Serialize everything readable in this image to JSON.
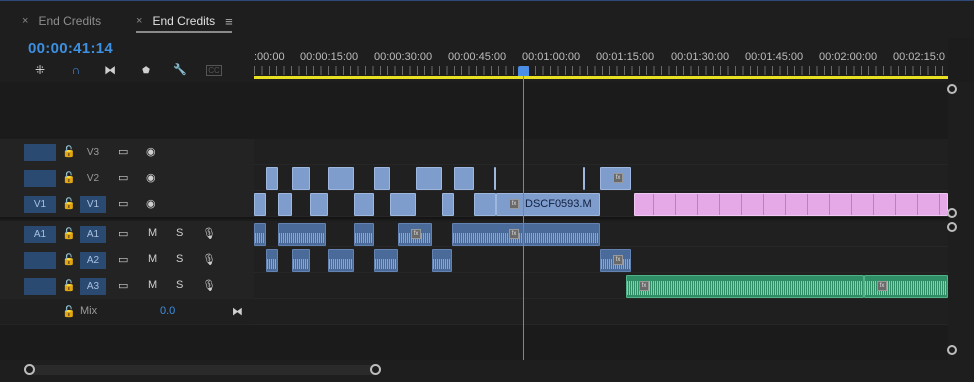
{
  "tabs": [
    {
      "close": "×",
      "label": "End Credits",
      "active": false
    },
    {
      "close": "×",
      "label": "End Credits",
      "active": true,
      "menu": "≡"
    }
  ],
  "timecode": "00:00:41:14",
  "toolbar": {
    "tools": [
      {
        "name": "insert-overwrite-icon",
        "glyph": "⁜"
      },
      {
        "name": "snap-magnet-icon",
        "glyph": "∩"
      },
      {
        "name": "linked-selection-icon",
        "glyph": "⧓"
      },
      {
        "name": "add-marker-icon",
        "glyph": "⬟"
      },
      {
        "name": "wrench-settings-icon",
        "glyph": "🔧"
      },
      {
        "name": "captions-icon",
        "glyph": "CC"
      }
    ]
  },
  "ruler": {
    "labels": [
      ":00:00",
      "00:00:15:00",
      "00:00:30:00",
      "00:00:45:00",
      "00:01:00:00",
      "00:01:15:00",
      "00:01:30:00",
      "00:01:45:00",
      "00:02:00:00",
      "00:02:15:0"
    ]
  },
  "tracks": {
    "video": [
      {
        "id": "V3",
        "source": "",
        "lock": "🔓",
        "sync": "▭",
        "eye": "◉"
      },
      {
        "id": "V2",
        "source": "",
        "lock": "🔓",
        "sync": "▭",
        "eye": "◉"
      },
      {
        "id": "V1",
        "source": "V1",
        "lock": "🔓",
        "sync": "▭",
        "eye": "◉"
      }
    ],
    "audio": [
      {
        "id": "A1",
        "source": "A1",
        "lock": "🔓",
        "sync": "▭",
        "mute": "M",
        "solo": "S",
        "mic": "🎙"
      },
      {
        "id": "A2",
        "source": "",
        "lock": "🔓",
        "sync": "▭",
        "mute": "M",
        "solo": "S",
        "mic": "🎙"
      },
      {
        "id": "A3",
        "source": "",
        "lock": "🔓",
        "sync": "▭",
        "mute": "M",
        "solo": "S",
        "mic": "🎙"
      }
    ],
    "mix": {
      "lock": "🔓",
      "label": "Mix",
      "value": "0.0",
      "end_icon": "⧓"
    }
  },
  "clips": {
    "v1_name": "DSCF0593.M",
    "fx_label": "fx"
  },
  "colors": {
    "accent": "#3d8fe0",
    "video_clip": "#7e9ccc",
    "audio_clip": "#4a6a99",
    "pink_clip": "#e4a9e6",
    "green_clip": "#2f8e66",
    "work_area": "#e8e020"
  }
}
